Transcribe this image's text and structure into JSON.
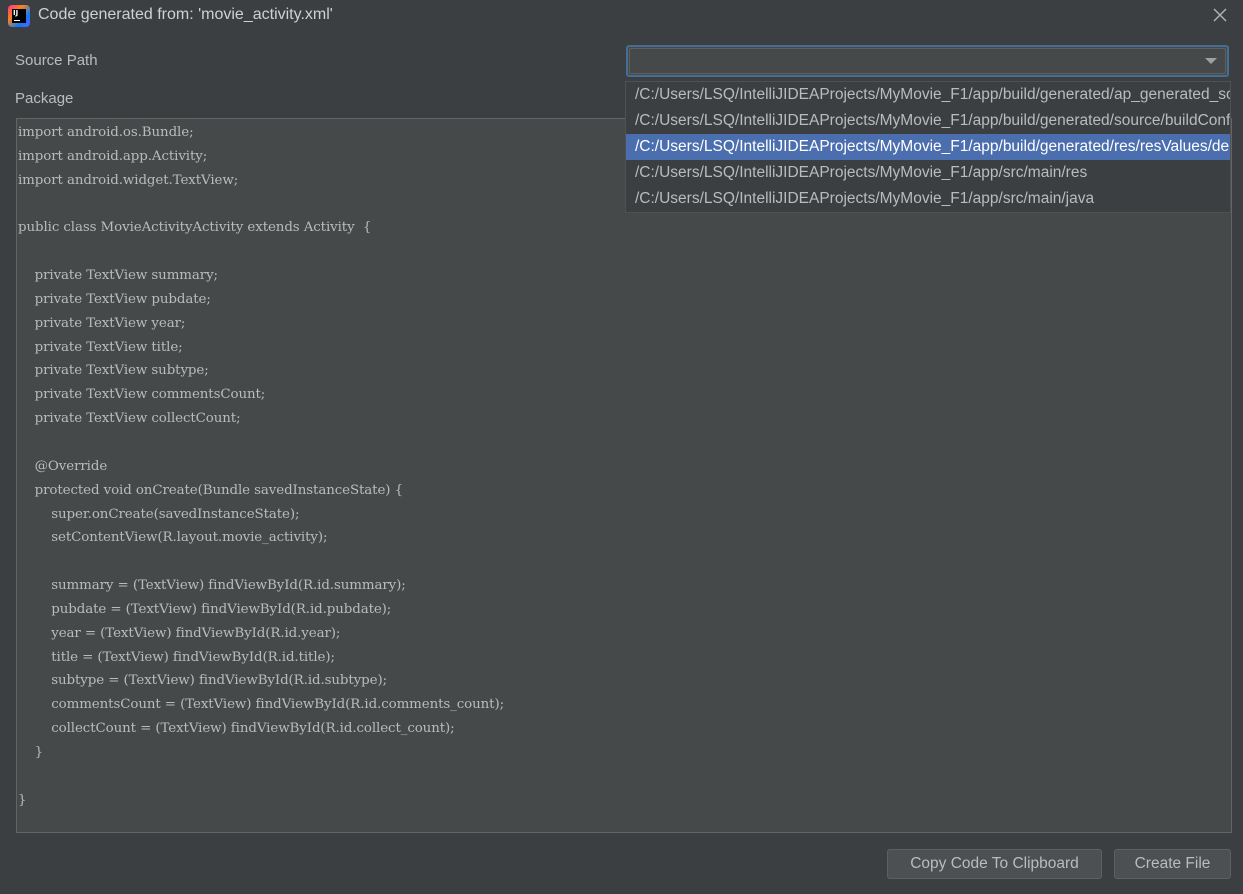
{
  "window": {
    "title": "Code generated from: 'movie_activity.xml'",
    "app_icon_text": "IJ"
  },
  "form": {
    "source_path_label": "Source Path",
    "package_label": "Package",
    "source_path_value": ""
  },
  "dropdown": {
    "selected_index": 2,
    "options": [
      "/C:/Users/LSQ/IntelliJIDEAProjects/MyMovie_F1/app/build/generated/ap_generated_sources/debug/out",
      "/C:/Users/LSQ/IntelliJIDEAProjects/MyMovie_F1/app/build/generated/source/buildConfig/debug",
      "/C:/Users/LSQ/IntelliJIDEAProjects/MyMovie_F1/app/build/generated/res/resValues/debug",
      "/C:/Users/LSQ/IntelliJIDEAProjects/MyMovie_F1/app/src/main/res",
      "/C:/Users/LSQ/IntelliJIDEAProjects/MyMovie_F1/app/src/main/java"
    ]
  },
  "code": {
    "lines": [
      "import android.os.Bundle;",
      "import android.app.Activity;",
      "import android.widget.TextView;",
      "",
      "public class MovieActivityActivity extends Activity  {",
      "",
      "    private TextView summary;",
      "    private TextView pubdate;",
      "    private TextView year;",
      "    private TextView title;",
      "    private TextView subtype;",
      "    private TextView commentsCount;",
      "    private TextView collectCount;",
      "",
      "    @Override",
      "    protected void onCreate(Bundle savedInstanceState) {",
      "        super.onCreate(savedInstanceState);",
      "        setContentView(R.layout.movie_activity);",
      "",
      "        summary = (TextView) findViewById(R.id.summary);",
      "        pubdate = (TextView) findViewById(R.id.pubdate);",
      "        year = (TextView) findViewById(R.id.year);",
      "        title = (TextView) findViewById(R.id.title);",
      "        subtype = (TextView) findViewById(R.id.subtype);",
      "        commentsCount = (TextView) findViewById(R.id.comments_count);",
      "        collectCount = (TextView) findViewById(R.id.collect_count);",
      "    }",
      "",
      "}"
    ]
  },
  "buttons": {
    "copy_label": "Copy Code To Clipboard",
    "create_label": "Create File"
  },
  "colors": {
    "background": "#3c3f41",
    "selection": "#4b6eaf",
    "focus_border": "#466d94",
    "text": "#bbbbbb"
  },
  "icons": {
    "app": "intellij-idea-icon",
    "close": "close-icon",
    "combo_arrow": "chevron-down-icon"
  }
}
